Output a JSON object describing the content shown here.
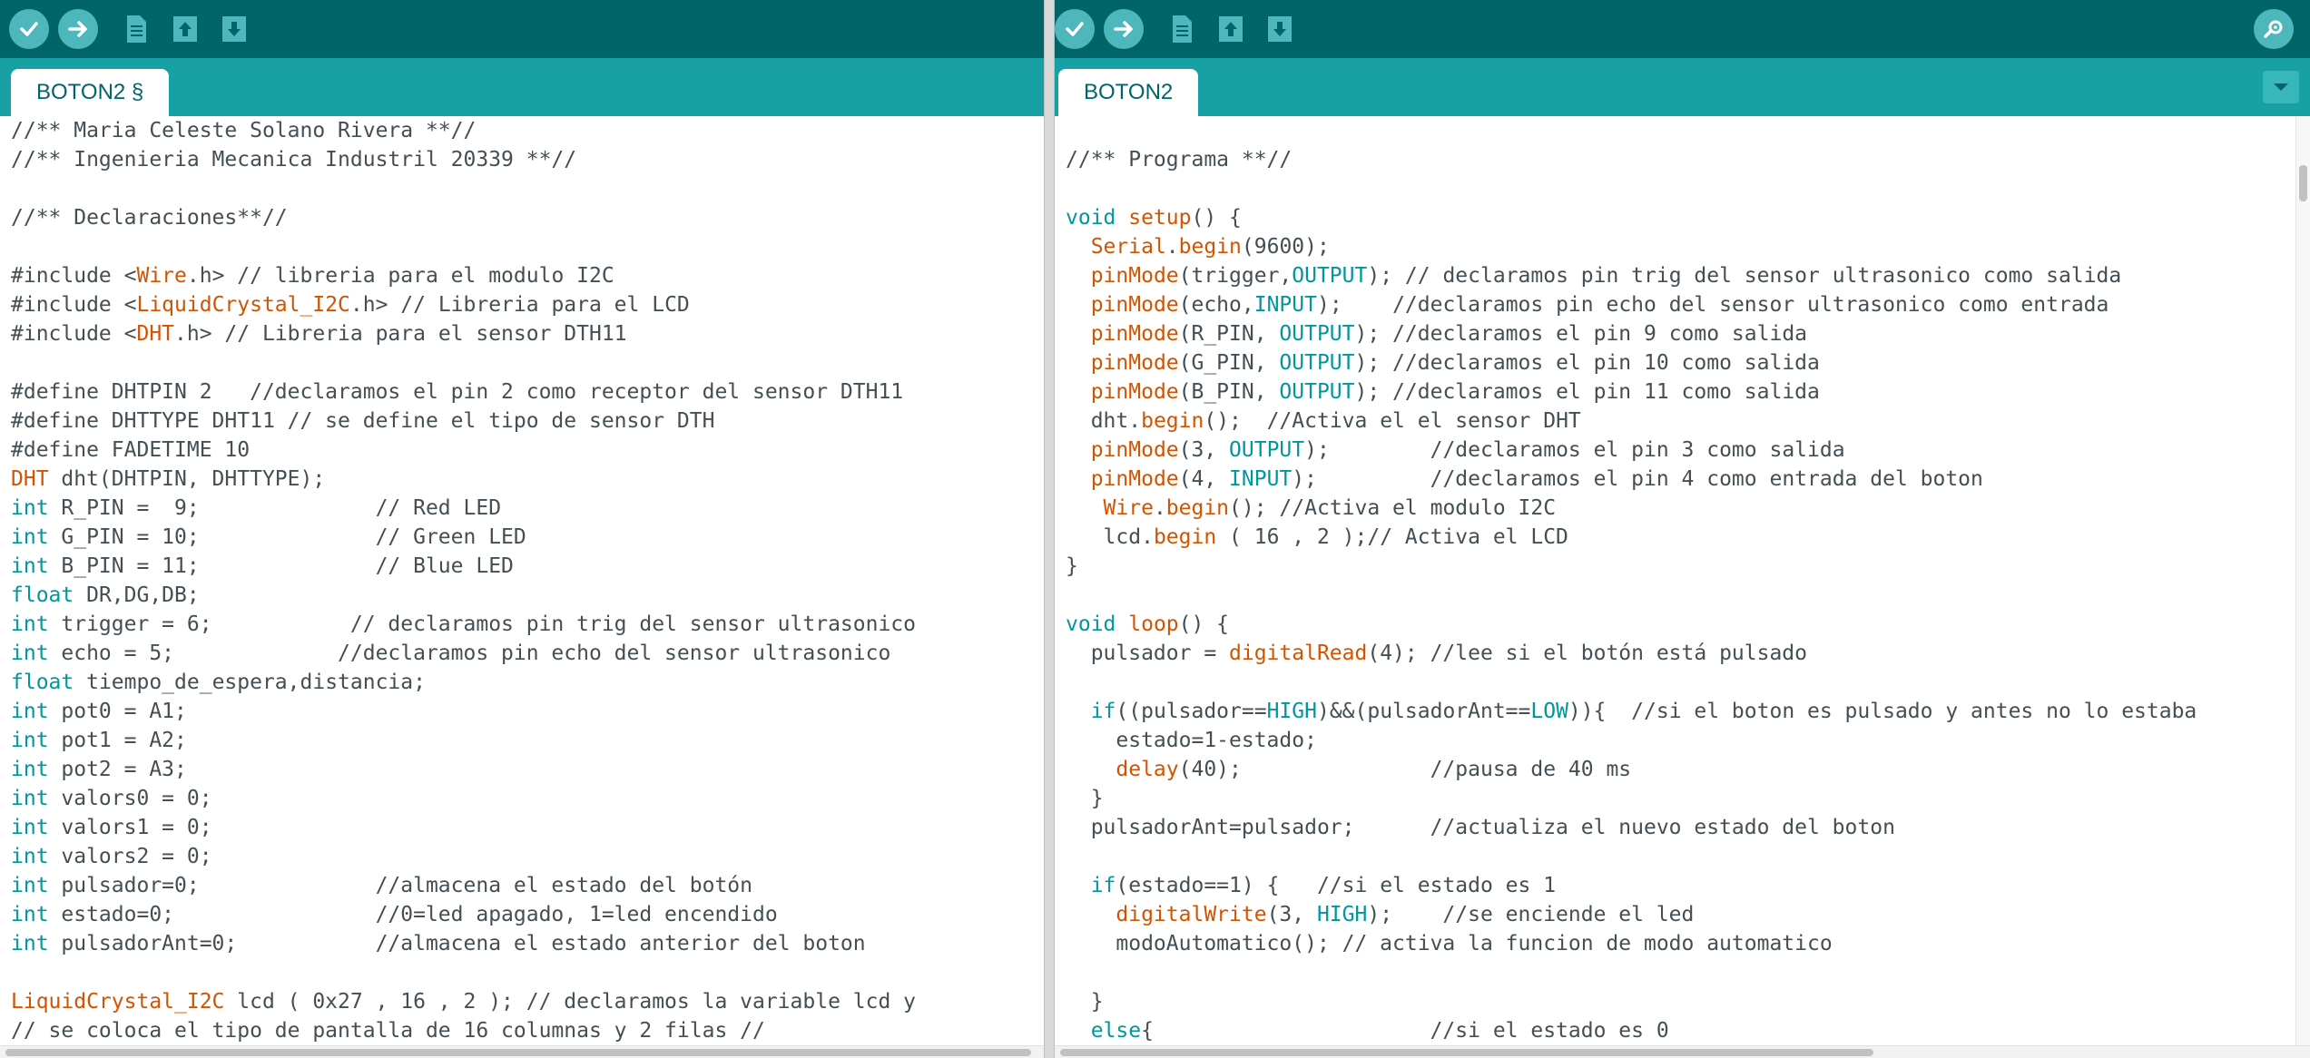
{
  "left": {
    "tab_label": "BOTON2 §",
    "toolbar": [
      {
        "icon": "verify-icon"
      },
      {
        "icon": "upload-icon"
      },
      {
        "icon": "new-sketch-icon"
      },
      {
        "icon": "open-icon"
      },
      {
        "icon": "save-icon"
      }
    ],
    "lines": [
      [
        [
          "c",
          "//** Maria Celeste Solano Rivera **//"
        ]
      ],
      [
        [
          "c",
          "//** Ingenieria Mecanica Industril 20339 **//"
        ]
      ],
      [
        [
          "c",
          ""
        ]
      ],
      [
        [
          "c",
          "//** Declaraciones**//"
        ]
      ],
      [
        [
          "c",
          ""
        ]
      ],
      [
        [
          "c",
          "#include <"
        ],
        [
          "f",
          "Wire"
        ],
        [
          "c",
          ".h> // libreria para el modulo I2C"
        ]
      ],
      [
        [
          "c",
          "#include <"
        ],
        [
          "f",
          "LiquidCrystal_I2C"
        ],
        [
          "c",
          ".h> // Libreria para el LCD"
        ]
      ],
      [
        [
          "c",
          "#include <"
        ],
        [
          "f",
          "DHT"
        ],
        [
          "c",
          ".h> // Libreria para el sensor DTH11"
        ]
      ],
      [
        [
          "c",
          ""
        ]
      ],
      [
        [
          "c",
          "#define DHTPIN 2   //declaramos el pin 2 como receptor del sensor DTH11"
        ]
      ],
      [
        [
          "c",
          "#define DHTTYPE DHT11 // se define el tipo de sensor DTH"
        ]
      ],
      [
        [
          "c",
          "#define FADETIME 10"
        ]
      ],
      [
        [
          "f",
          "DHT"
        ],
        [
          "c",
          " dht(DHTPIN, DHTTYPE);"
        ]
      ],
      [
        [
          "k",
          "int"
        ],
        [
          "c",
          " R_PIN =  9;              // Red LED"
        ]
      ],
      [
        [
          "k",
          "int"
        ],
        [
          "c",
          " G_PIN = 10;              // Green LED"
        ]
      ],
      [
        [
          "k",
          "int"
        ],
        [
          "c",
          " B_PIN = 11;              // Blue LED"
        ]
      ],
      [
        [
          "k",
          "float"
        ],
        [
          "c",
          " DR,DG,DB;"
        ]
      ],
      [
        [
          "k",
          "int"
        ],
        [
          "c",
          " trigger = 6;           // declaramos pin trig del sensor ultrasonico"
        ]
      ],
      [
        [
          "k",
          "int"
        ],
        [
          "c",
          " echo = 5;             //declaramos pin echo del sensor ultrasonico"
        ]
      ],
      [
        [
          "k",
          "float"
        ],
        [
          "c",
          " tiempo_de_espera,distancia;"
        ]
      ],
      [
        [
          "k",
          "int"
        ],
        [
          "c",
          " pot0 = A1;"
        ]
      ],
      [
        [
          "k",
          "int"
        ],
        [
          "c",
          " pot1 = A2;"
        ]
      ],
      [
        [
          "k",
          "int"
        ],
        [
          "c",
          " pot2 = A3;"
        ]
      ],
      [
        [
          "k",
          "int"
        ],
        [
          "c",
          " valors0 = 0;"
        ]
      ],
      [
        [
          "k",
          "int"
        ],
        [
          "c",
          " valors1 = 0;"
        ]
      ],
      [
        [
          "k",
          "int"
        ],
        [
          "c",
          " valors2 = 0;"
        ]
      ],
      [
        [
          "k",
          "int"
        ],
        [
          "c",
          " pulsador=0;              //almacena el estado del botón"
        ]
      ],
      [
        [
          "k",
          "int"
        ],
        [
          "c",
          " estado=0;                //0=led apagado, 1=led encendido"
        ]
      ],
      [
        [
          "k",
          "int"
        ],
        [
          "c",
          " pulsadorAnt=0;           //almacena el estado anterior del boton"
        ]
      ],
      [
        [
          "c",
          ""
        ]
      ],
      [
        [
          "f",
          "LiquidCrystal_I2C"
        ],
        [
          "c",
          " lcd ( 0x27 , 16 , 2 ); // declaramos la variable lcd y"
        ]
      ],
      [
        [
          "c",
          "// se coloca el tipo de pantalla de 16 columnas y 2 filas //"
        ]
      ]
    ]
  },
  "right": {
    "tab_label": "BOTON2",
    "toolbar": [
      {
        "icon": "verify-icon"
      },
      {
        "icon": "upload-icon"
      },
      {
        "icon": "new-sketch-icon"
      },
      {
        "icon": "open-icon"
      },
      {
        "icon": "save-icon"
      }
    ],
    "serial_monitor_icon": "serial-monitor-icon",
    "tab_menu_icon": "tab-menu-icon",
    "lines": [
      [
        [
          "c",
          ""
        ]
      ],
      [
        [
          "c",
          "//** Programa **//"
        ]
      ],
      [
        [
          "c",
          ""
        ]
      ],
      [
        [
          "k",
          "void"
        ],
        [
          "c",
          " "
        ],
        [
          "f",
          "setup"
        ],
        [
          "c",
          "() {"
        ]
      ],
      [
        [
          "c",
          "  "
        ],
        [
          "f",
          "Serial"
        ],
        [
          "c",
          "."
        ],
        [
          "f",
          "begin"
        ],
        [
          "c",
          "(9600);"
        ]
      ],
      [
        [
          "c",
          "  "
        ],
        [
          "f",
          "pinMode"
        ],
        [
          "c",
          "(trigger,"
        ],
        [
          "k",
          "OUTPUT"
        ],
        [
          "c",
          "); // declaramos pin trig del sensor ultrasonico como salida"
        ]
      ],
      [
        [
          "c",
          "  "
        ],
        [
          "f",
          "pinMode"
        ],
        [
          "c",
          "(echo,"
        ],
        [
          "k",
          "INPUT"
        ],
        [
          "c",
          ");    //declaramos pin echo del sensor ultrasonico como entrada"
        ]
      ],
      [
        [
          "c",
          "  "
        ],
        [
          "f",
          "pinMode"
        ],
        [
          "c",
          "(R_PIN, "
        ],
        [
          "k",
          "OUTPUT"
        ],
        [
          "c",
          "); //declaramos el pin 9 como salida"
        ]
      ],
      [
        [
          "c",
          "  "
        ],
        [
          "f",
          "pinMode"
        ],
        [
          "c",
          "(G_PIN, "
        ],
        [
          "k",
          "OUTPUT"
        ],
        [
          "c",
          "); //declaramos el pin 10 como salida"
        ]
      ],
      [
        [
          "c",
          "  "
        ],
        [
          "f",
          "pinMode"
        ],
        [
          "c",
          "(B_PIN, "
        ],
        [
          "k",
          "OUTPUT"
        ],
        [
          "c",
          "); //declaramos el pin 11 como salida"
        ]
      ],
      [
        [
          "c",
          "  dht."
        ],
        [
          "f",
          "begin"
        ],
        [
          "c",
          "();  //Activa el el sensor DHT"
        ]
      ],
      [
        [
          "c",
          "  "
        ],
        [
          "f",
          "pinMode"
        ],
        [
          "c",
          "(3, "
        ],
        [
          "k",
          "OUTPUT"
        ],
        [
          "c",
          ");        //declaramos el pin 3 como salida"
        ]
      ],
      [
        [
          "c",
          "  "
        ],
        [
          "f",
          "pinMode"
        ],
        [
          "c",
          "(4, "
        ],
        [
          "k",
          "INPUT"
        ],
        [
          "c",
          ");         //declaramos el pin 4 como entrada del boton"
        ]
      ],
      [
        [
          "c",
          "   "
        ],
        [
          "f",
          "Wire"
        ],
        [
          "c",
          "."
        ],
        [
          "f",
          "begin"
        ],
        [
          "c",
          "(); //Activa el modulo I2C"
        ]
      ],
      [
        [
          "c",
          "   lcd."
        ],
        [
          "f",
          "begin"
        ],
        [
          "c",
          " ( 16 , 2 );// Activa el LCD"
        ]
      ],
      [
        [
          "c",
          "}"
        ]
      ],
      [
        [
          "c",
          ""
        ]
      ],
      [
        [
          "k",
          "void"
        ],
        [
          "c",
          " "
        ],
        [
          "f",
          "loop"
        ],
        [
          "c",
          "() {"
        ]
      ],
      [
        [
          "c",
          "  pulsador = "
        ],
        [
          "f",
          "digitalRead"
        ],
        [
          "c",
          "(4); //lee si el botón está pulsado"
        ]
      ],
      [
        [
          "c",
          ""
        ]
      ],
      [
        [
          "c",
          "  "
        ],
        [
          "k",
          "if"
        ],
        [
          "c",
          "((pulsador=="
        ],
        [
          "k",
          "HIGH"
        ],
        [
          "c",
          ")&&(pulsadorAnt=="
        ],
        [
          "k",
          "LOW"
        ],
        [
          "c",
          ")){  //si el boton es pulsado y antes no lo estaba"
        ]
      ],
      [
        [
          "c",
          "    estado=1-estado;"
        ]
      ],
      [
        [
          "c",
          "    "
        ],
        [
          "f",
          "delay"
        ],
        [
          "c",
          "(40);               //pausa de 40 ms"
        ]
      ],
      [
        [
          "c",
          "  }"
        ]
      ],
      [
        [
          "c",
          "  pulsadorAnt=pulsador;      //actualiza el nuevo estado del boton"
        ]
      ],
      [
        [
          "c",
          ""
        ]
      ],
      [
        [
          "c",
          "  "
        ],
        [
          "k",
          "if"
        ],
        [
          "c",
          "(estado==1) {   //si el estado es 1"
        ]
      ],
      [
        [
          "c",
          "    "
        ],
        [
          "f",
          "digitalWrite"
        ],
        [
          "c",
          "(3, "
        ],
        [
          "k",
          "HIGH"
        ],
        [
          "c",
          ");    //se enciende el led"
        ]
      ],
      [
        [
          "c",
          "    modoAutomatico(); // activa la funcion de modo automatico"
        ]
      ],
      [
        [
          "c",
          ""
        ]
      ],
      [
        [
          "c",
          "  }"
        ]
      ],
      [
        [
          "c",
          "  "
        ],
        [
          "k",
          "else"
        ],
        [
          "c",
          "{                      //si el estado es 0"
        ]
      ]
    ]
  }
}
